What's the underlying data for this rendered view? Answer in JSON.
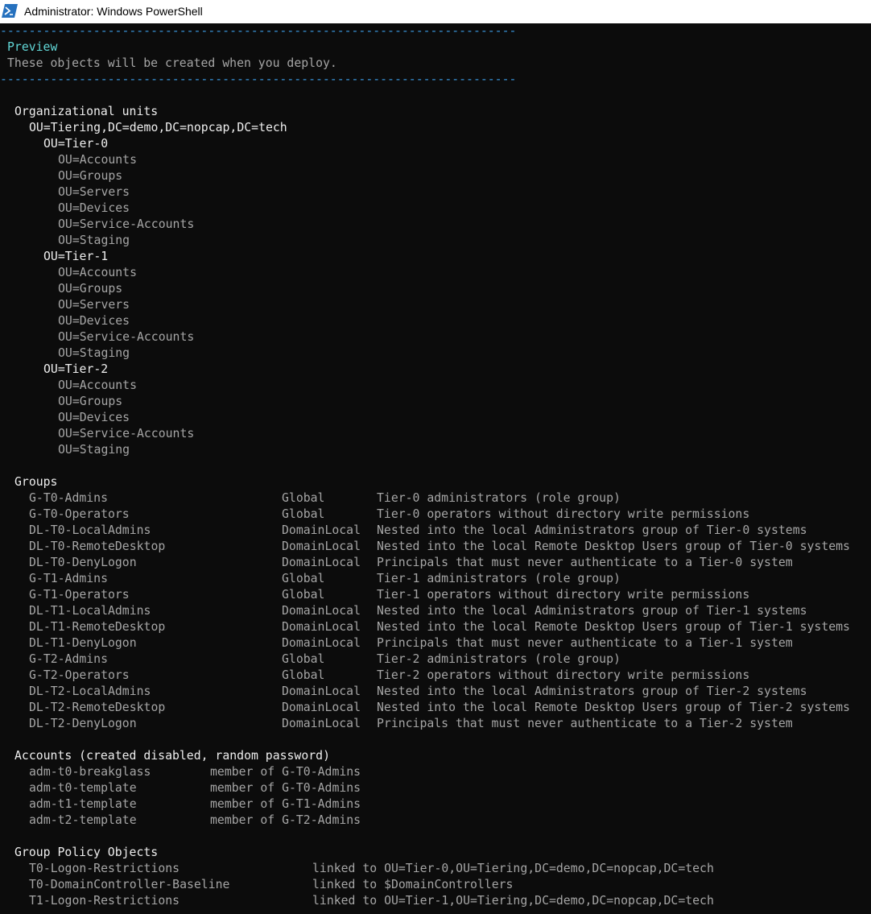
{
  "window": {
    "title": "Administrator: Windows PowerShell",
    "icon": "powershell-icon"
  },
  "colors": {
    "background": "#0c0c0c",
    "separator": "#3a96dd",
    "heading_cyan": "#61d6d6",
    "text_gray": "#a5a5a5",
    "text_white": "#eeeeee"
  },
  "header": {
    "separator": "------------------------------------------------------------------------",
    "title": "Preview",
    "subtitle": "These objects will be created when you deploy."
  },
  "ous": {
    "heading": "Organizational units",
    "root": "OU=Tiering,DC=demo,DC=nopcap,DC=tech",
    "tiers": [
      {
        "name": "OU=Tier-0",
        "children": [
          "OU=Accounts",
          "OU=Groups",
          "OU=Servers",
          "OU=Devices",
          "OU=Service-Accounts",
          "OU=Staging"
        ]
      },
      {
        "name": "OU=Tier-1",
        "children": [
          "OU=Accounts",
          "OU=Groups",
          "OU=Servers",
          "OU=Devices",
          "OU=Service-Accounts",
          "OU=Staging"
        ]
      },
      {
        "name": "OU=Tier-2",
        "children": [
          "OU=Accounts",
          "OU=Groups",
          "OU=Devices",
          "OU=Service-Accounts",
          "OU=Staging"
        ]
      }
    ]
  },
  "groups": {
    "heading": "Groups",
    "rows": [
      {
        "name": "G-T0-Admins",
        "scope": "Global",
        "desc": "Tier-0 administrators (role group)"
      },
      {
        "name": "G-T0-Operators",
        "scope": "Global",
        "desc": "Tier-0 operators without directory write permissions"
      },
      {
        "name": "DL-T0-LocalAdmins",
        "scope": "DomainLocal",
        "desc": "Nested into the local Administrators group of Tier-0 systems"
      },
      {
        "name": "DL-T0-RemoteDesktop",
        "scope": "DomainLocal",
        "desc": "Nested into the local Remote Desktop Users group of Tier-0 systems"
      },
      {
        "name": "DL-T0-DenyLogon",
        "scope": "DomainLocal",
        "desc": "Principals that must never authenticate to a Tier-0 system"
      },
      {
        "name": "G-T1-Admins",
        "scope": "Global",
        "desc": "Tier-1 administrators (role group)"
      },
      {
        "name": "G-T1-Operators",
        "scope": "Global",
        "desc": "Tier-1 operators without directory write permissions"
      },
      {
        "name": "DL-T1-LocalAdmins",
        "scope": "DomainLocal",
        "desc": "Nested into the local Administrators group of Tier-1 systems"
      },
      {
        "name": "DL-T1-RemoteDesktop",
        "scope": "DomainLocal",
        "desc": "Nested into the local Remote Desktop Users group of Tier-1 systems"
      },
      {
        "name": "DL-T1-DenyLogon",
        "scope": "DomainLocal",
        "desc": "Principals that must never authenticate to a Tier-1 system"
      },
      {
        "name": "G-T2-Admins",
        "scope": "Global",
        "desc": "Tier-2 administrators (role group)"
      },
      {
        "name": "G-T2-Operators",
        "scope": "Global",
        "desc": "Tier-2 operators without directory write permissions"
      },
      {
        "name": "DL-T2-LocalAdmins",
        "scope": "DomainLocal",
        "desc": "Nested into the local Administrators group of Tier-2 systems"
      },
      {
        "name": "DL-T2-RemoteDesktop",
        "scope": "DomainLocal",
        "desc": "Nested into the local Remote Desktop Users group of Tier-2 systems"
      },
      {
        "name": "DL-T2-DenyLogon",
        "scope": "DomainLocal",
        "desc": "Principals that must never authenticate to a Tier-2 system"
      }
    ]
  },
  "accounts": {
    "heading": "Accounts (created disabled, random password)",
    "rows": [
      {
        "name": "adm-t0-breakglass",
        "desc": "member of G-T0-Admins"
      },
      {
        "name": "adm-t0-template",
        "desc": "member of G-T0-Admins"
      },
      {
        "name": "adm-t1-template",
        "desc": "member of G-T1-Admins"
      },
      {
        "name": "adm-t2-template",
        "desc": "member of G-T2-Admins"
      }
    ]
  },
  "gpos": {
    "heading": "Group Policy Objects",
    "rows": [
      {
        "name": "T0-Logon-Restrictions",
        "desc": "linked to OU=Tier-0,OU=Tiering,DC=demo,DC=nopcap,DC=tech"
      },
      {
        "name": "T0-DomainController-Baseline",
        "desc": "linked to $DomainControllers"
      },
      {
        "name": "T1-Logon-Restrictions",
        "desc": "linked to OU=Tier-1,OU=Tiering,DC=demo,DC=nopcap,DC=tech"
      }
    ]
  }
}
